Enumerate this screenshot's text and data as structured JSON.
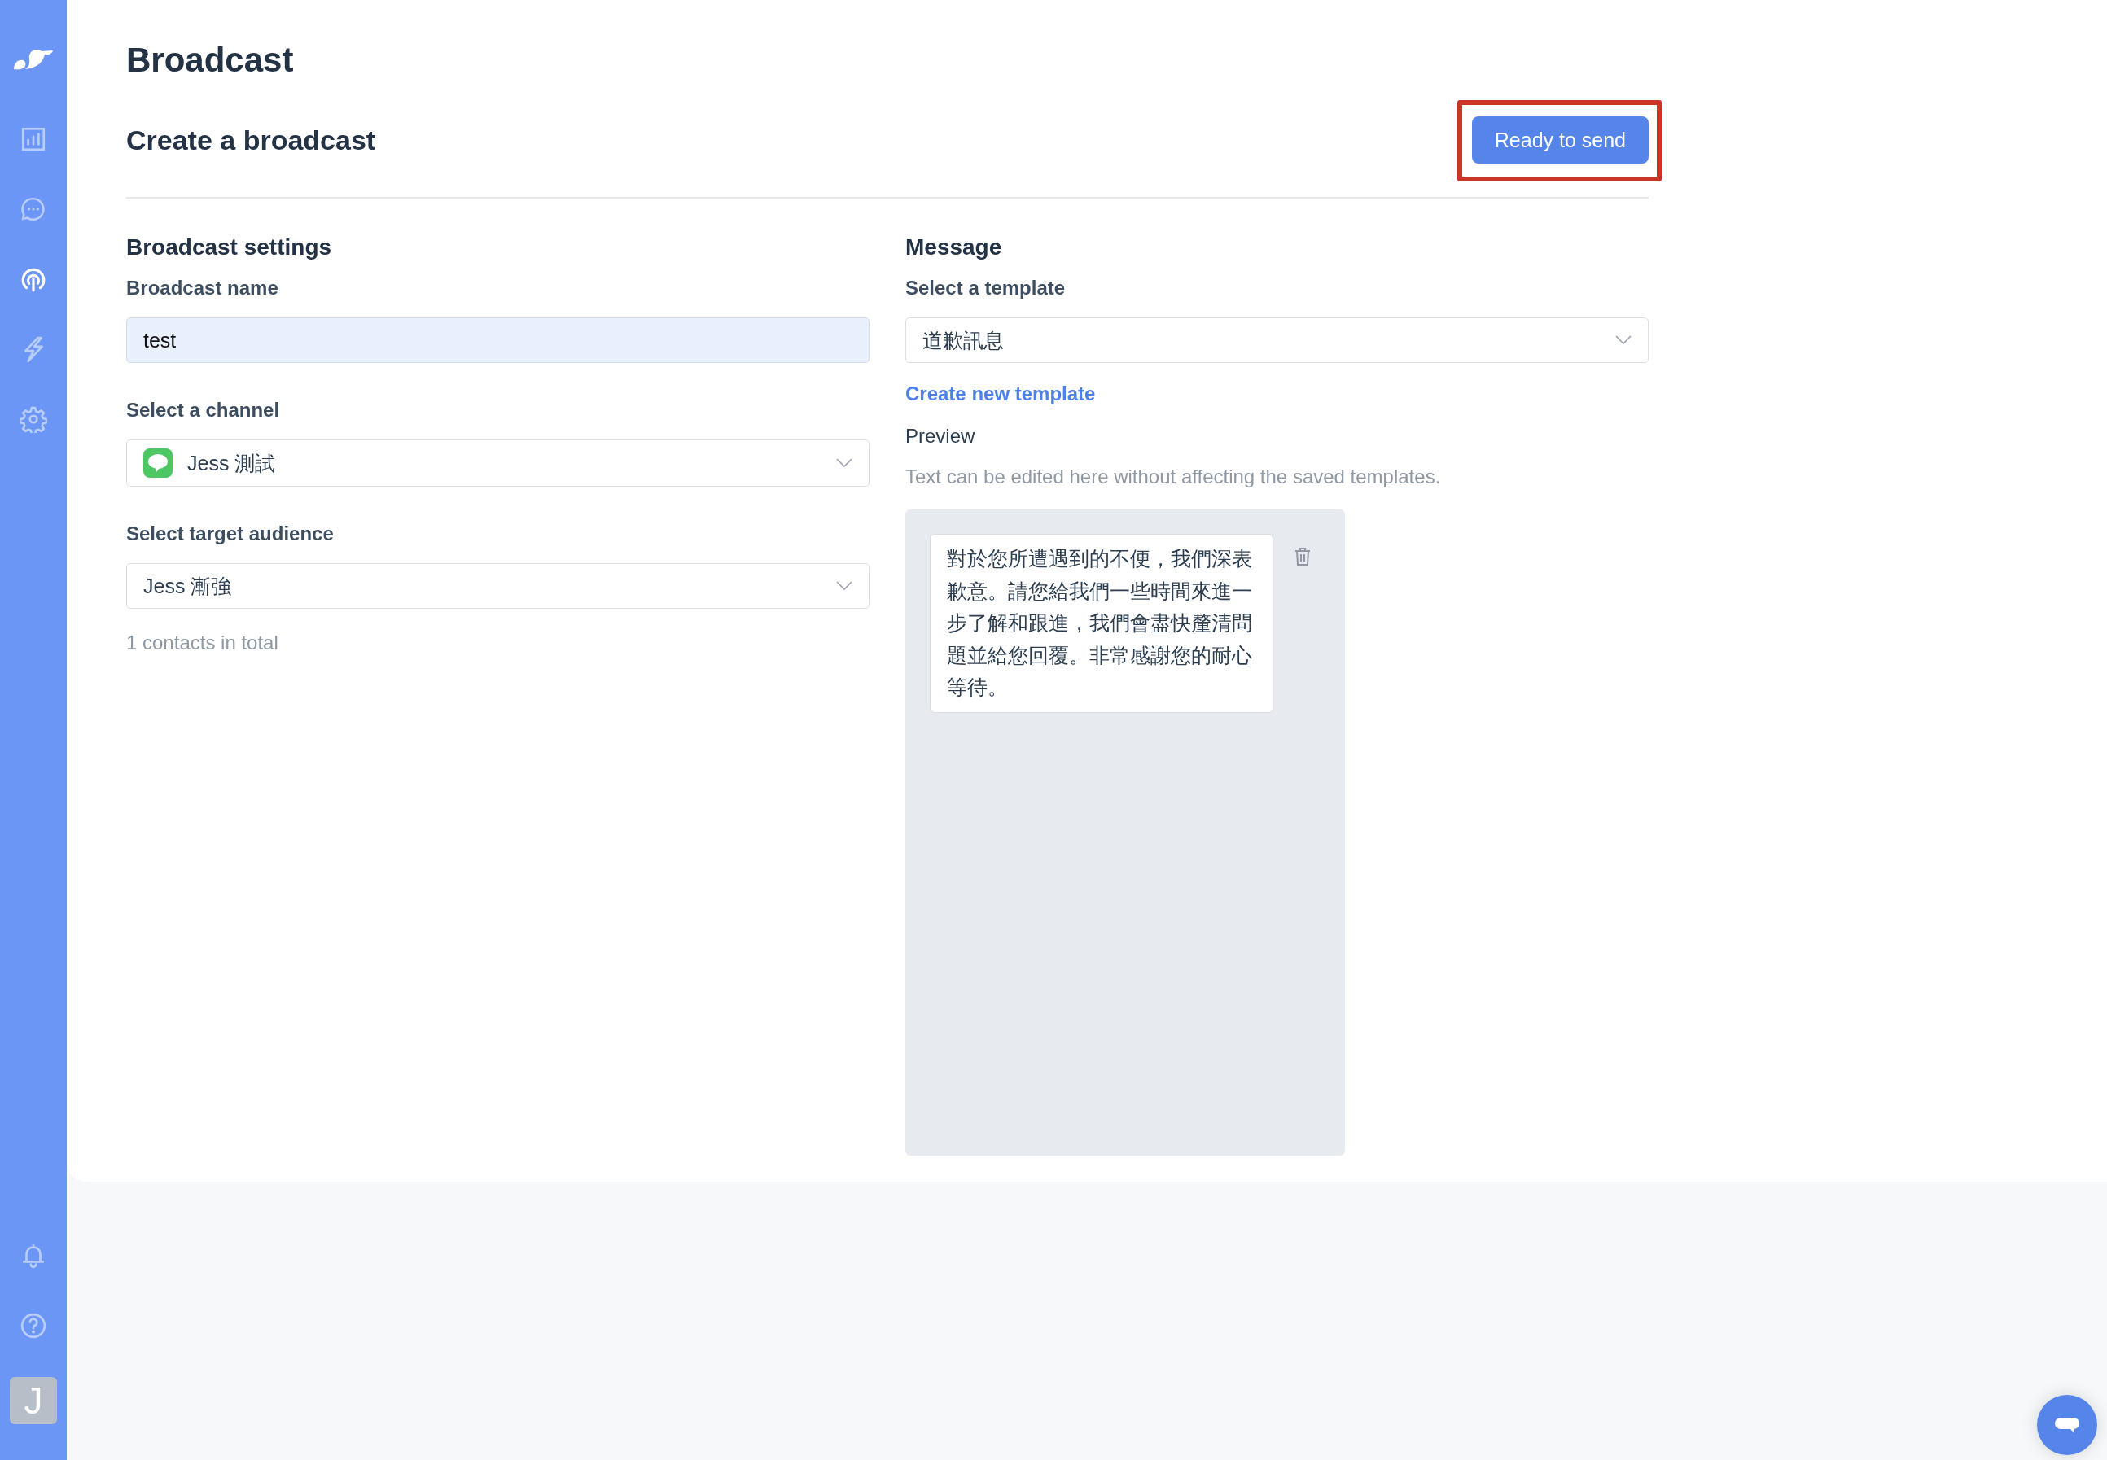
{
  "sidebar": {
    "nav": [
      {
        "kind": "chart",
        "selected": false
      },
      {
        "kind": "chat",
        "selected": false
      },
      {
        "kind": "broadcast",
        "selected": true
      },
      {
        "kind": "bolt",
        "selected": false
      },
      {
        "kind": "gear",
        "selected": false
      }
    ],
    "footer": [
      {
        "kind": "bell"
      },
      {
        "kind": "help"
      }
    ],
    "avatar": "J"
  },
  "page_title": "Broadcast",
  "header": {
    "title": "Create a broadcast",
    "button": {
      "label": "Ready to send",
      "highlighted": true
    }
  },
  "settings": {
    "heading": "Broadcast settings",
    "name_label": "Broadcast name",
    "name_value": "test",
    "channel_label": "Select a channel",
    "channel_value": "Jess 測試",
    "audience_label": "Select target audience",
    "audience_value": "Jess 漸強",
    "contacts": "1 contacts in total"
  },
  "message": {
    "heading": "Message",
    "template_label": "Select a template",
    "template_value": "道歉訊息",
    "create_link": "Create new template",
    "preview_label": "Preview",
    "hint": "Text can be edited here without affecting the saved templates.",
    "bubble": "對於您所遭遇到的不便，我們深表歉意。請您給我們一些時間來進一步了解和跟進，我們會盡快釐清問題並給您回覆。非常感謝您的耐心等待。"
  }
}
